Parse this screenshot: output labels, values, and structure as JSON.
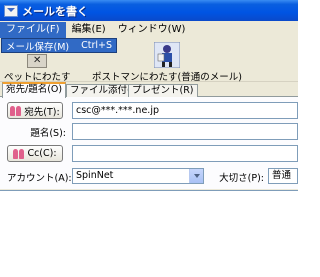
{
  "window": {
    "title": "メールを書く"
  },
  "menubar": {
    "items": [
      {
        "label": "ファイル(F)",
        "name": "menu-file",
        "active": true
      },
      {
        "label": "編集(E)",
        "name": "menu-edit"
      },
      {
        "label": "ウィンドウ(W)",
        "name": "menu-window"
      }
    ]
  },
  "dropdown": {
    "label": "メール保存(M)",
    "shortcut": "Ctrl+S"
  },
  "toolbar": {
    "pet_label": "ペットにわたす",
    "postman_label": "ポストマンにわたす(普通のメール)"
  },
  "tabs": [
    {
      "label": "宛先/題名(O)"
    },
    {
      "label": "ファイル添付(H)"
    },
    {
      "label": "プレゼント(R)"
    }
  ],
  "form": {
    "to_label": "宛先(T):",
    "to_value": "csc@***.***.ne.jp",
    "subject_label": "題名(S):",
    "subject_value": "",
    "cc_label": "Cc(C):",
    "cc_value": "",
    "account_label": "アカウント(A):",
    "account_value": "SpinNet",
    "importance_label": "大切さ(P):",
    "importance_value": "普通"
  },
  "colors": {
    "title_bar": "#0054e3",
    "selection": "#316ac5",
    "tab_highlight": "#f0a030"
  }
}
